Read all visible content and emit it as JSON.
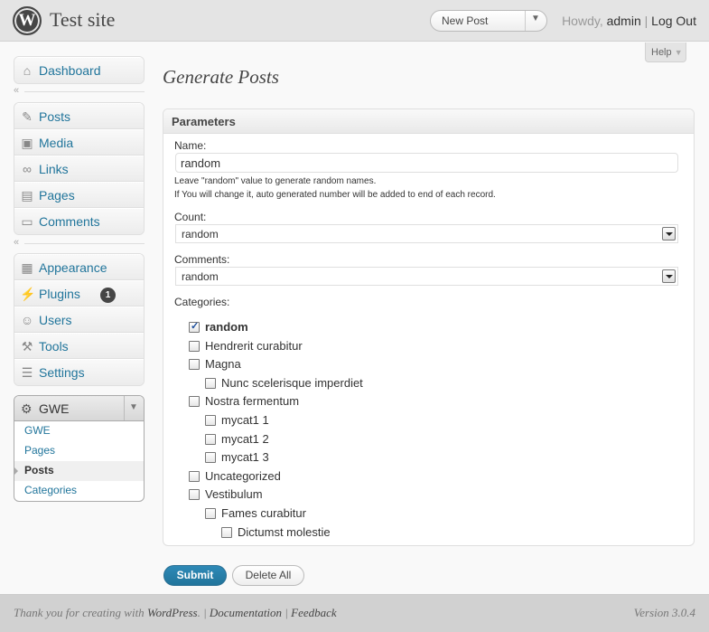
{
  "header": {
    "site_title": "Test site",
    "new_post": "New Post",
    "howdy": "Howdy,",
    "username": "admin",
    "separator": "|",
    "logout": "Log Out",
    "help": "Help"
  },
  "sidebar": {
    "dashboard": "Dashboard",
    "posts": "Posts",
    "media": "Media",
    "links": "Links",
    "pages": "Pages",
    "comments": "Comments",
    "appearance": "Appearance",
    "plugins": "Plugins",
    "plugins_badge": "1",
    "users": "Users",
    "tools": "Tools",
    "settings": "Settings",
    "gwe": {
      "title": "GWE",
      "items": [
        "GWE",
        "Pages",
        "Posts",
        "Categories"
      ],
      "current": "Posts"
    }
  },
  "main": {
    "title": "Generate Posts",
    "panel_title": "Parameters",
    "name_label": "Name:",
    "name_value": "random",
    "hint_line1": "Leave \"random\" value to generate random names.",
    "hint_line2": "If You will change it, auto generated number will be added to end of each record.",
    "count_label": "Count:",
    "count_value": "random",
    "comments_label": "Comments:",
    "comments_value": "random",
    "categories_label": "Categories:",
    "categories": [
      {
        "label": "random",
        "checked": true,
        "level": 0
      },
      {
        "label": "Hendrerit curabitur",
        "checked": false,
        "level": 0
      },
      {
        "label": "Magna",
        "checked": false,
        "level": 0
      },
      {
        "label": "Nunc scelerisque imperdiet",
        "checked": false,
        "level": 1
      },
      {
        "label": "Nostra fermentum",
        "checked": false,
        "level": 0
      },
      {
        "label": "mycat1 1",
        "checked": false,
        "level": 1
      },
      {
        "label": "mycat1 2",
        "checked": false,
        "level": 1
      },
      {
        "label": "mycat1 3",
        "checked": false,
        "level": 1
      },
      {
        "label": "Uncategorized",
        "checked": false,
        "level": 0
      },
      {
        "label": "Vestibulum",
        "checked": false,
        "level": 0
      },
      {
        "label": "Fames curabitur",
        "checked": false,
        "level": 1
      },
      {
        "label": "Dictumst molestie",
        "checked": false,
        "level": 2
      }
    ],
    "submit": "Submit",
    "delete_all": "Delete All"
  },
  "footer": {
    "thanks": "Thank you for creating with",
    "wordpress": "WordPress",
    "documentation": "Documentation",
    "feedback": "Feedback",
    "version": "Version 3.0.4"
  },
  "colors": {
    "link": "#21759b",
    "primary_button": "#21759b",
    "header_bg": "#e4e4e4"
  }
}
